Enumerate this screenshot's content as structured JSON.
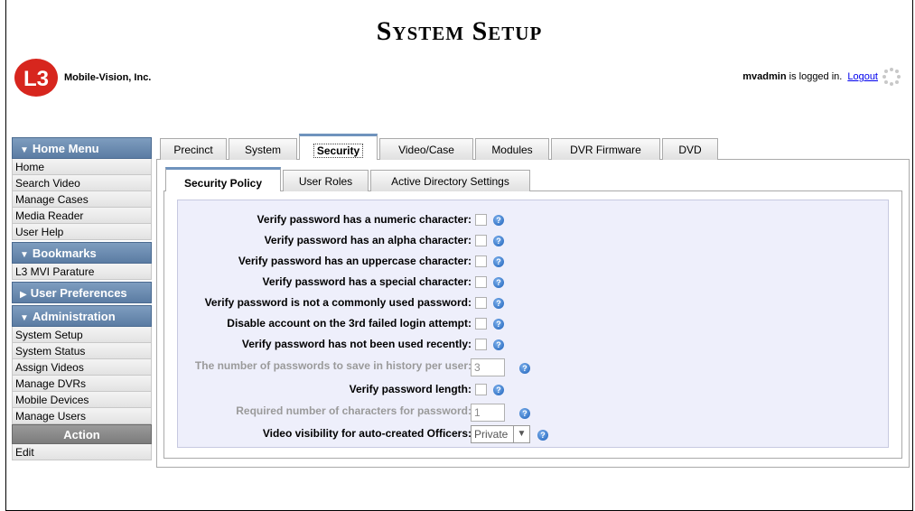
{
  "header": {
    "title": "System Setup",
    "company": "Mobile-Vision, Inc.",
    "logo_text": "L3",
    "user": "mvadmin",
    "logged_in_text": " is logged in.",
    "logout_label": "Logout"
  },
  "sidebar": {
    "home_menu": {
      "title": "Home Menu",
      "items": [
        "Home",
        "Search Video",
        "Manage Cases",
        "Media Reader",
        "User Help"
      ]
    },
    "bookmarks": {
      "title": "Bookmarks",
      "items": [
        "L3 MVI Parature"
      ]
    },
    "user_prefs": {
      "title": "User Preferences"
    },
    "administration": {
      "title": "Administration",
      "items": [
        "System Setup",
        "System Status",
        "Assign Videos",
        "Manage DVRs",
        "Mobile Devices",
        "Manage Users"
      ]
    },
    "action": {
      "title": "Action",
      "items": [
        "Edit"
      ]
    }
  },
  "tabs": [
    "Precinct",
    "System",
    "Security",
    "Video/Case",
    "Modules",
    "DVR Firmware",
    "DVD"
  ],
  "active_tab": "Security",
  "subtabs": [
    "Security Policy",
    "User Roles",
    "Active Directory Settings"
  ],
  "active_subtab": "Security Policy",
  "form": {
    "numeric": {
      "label": "Verify password has a numeric character:",
      "checked": false
    },
    "alpha": {
      "label": "Verify password has an alpha character:",
      "checked": false
    },
    "uppercase": {
      "label": "Verify password has an uppercase character:",
      "checked": false
    },
    "special": {
      "label": "Verify password has a special character:",
      "checked": false
    },
    "common": {
      "label": "Verify password is not a commonly used password:",
      "checked": false
    },
    "disable": {
      "label": "Disable account on the 3rd failed login attempt:",
      "checked": false
    },
    "recent": {
      "label": "Verify password has not been used recently:",
      "checked": false
    },
    "history": {
      "label": "The number of passwords to save in history per user:",
      "value": "3"
    },
    "length": {
      "label": "Verify password length:",
      "checked": false
    },
    "required": {
      "label": "Required number of characters for password:",
      "value": "1"
    },
    "visibility": {
      "label": "Video visibility for auto-created Officers:",
      "value": "Private"
    }
  },
  "colors": {
    "sidebar_header": "#6d8db3",
    "form_bg": "#eeeffb",
    "tab_accent": "#6f93bd",
    "help_icon": "#1a5fb8"
  }
}
